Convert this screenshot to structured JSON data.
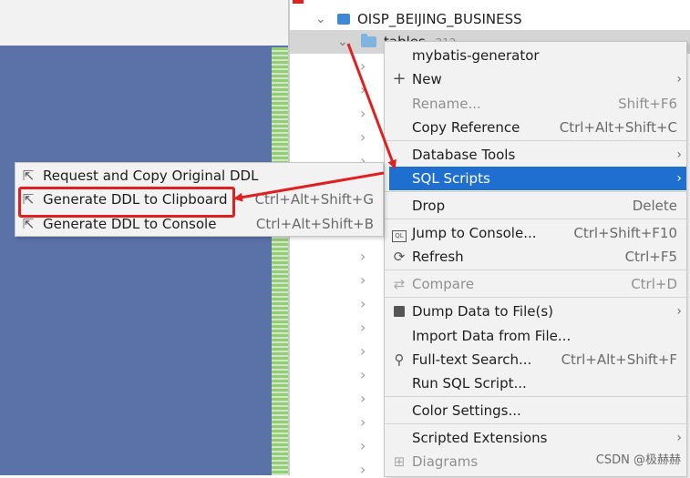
{
  "tree": {
    "rows": [
      {
        "label": "OISP_BEIJING_BUSINESS",
        "icon": "schema-icon"
      },
      {
        "label": "tables",
        "count": "212",
        "icon": "folder-icon"
      }
    ]
  },
  "context_menu": {
    "items": [
      {
        "label": "mybatis-generator",
        "shortcut": "",
        "icon": "",
        "has_submenu": false
      },
      {
        "label": "New",
        "shortcut": "",
        "icon": "plus-icon",
        "has_submenu": true
      },
      {
        "label": "Rename...",
        "shortcut": "Shift+F6",
        "icon": "",
        "has_submenu": false,
        "disabled": true
      },
      {
        "label": "Copy Reference",
        "shortcut": "Ctrl+Alt+Shift+C",
        "icon": "",
        "has_submenu": false
      },
      {
        "label": "Database Tools",
        "shortcut": "",
        "icon": "",
        "has_submenu": true
      },
      {
        "label": "SQL Scripts",
        "shortcut": "",
        "icon": "",
        "has_submenu": true,
        "highlighted": true
      },
      {
        "label": "Drop",
        "shortcut": "Delete",
        "icon": "",
        "has_submenu": false
      },
      {
        "label": "Jump to Console...",
        "shortcut": "Ctrl+Shift+F10",
        "icon": "console-icon",
        "has_submenu": false
      },
      {
        "label": "Refresh",
        "shortcut": "Ctrl+F5",
        "icon": "refresh-icon",
        "has_submenu": false
      },
      {
        "label": "Compare",
        "shortcut": "Ctrl+D",
        "icon": "compare-icon",
        "has_submenu": false,
        "disabled": true
      },
      {
        "label": "Dump Data to File(s)",
        "shortcut": "",
        "icon": "save-icon",
        "has_submenu": true
      },
      {
        "label": "Import Data from File...",
        "shortcut": "",
        "icon": "",
        "has_submenu": false
      },
      {
        "label": "Full-text Search...",
        "shortcut": "Ctrl+Alt+Shift+F",
        "icon": "search-icon",
        "has_submenu": false
      },
      {
        "label": "Run SQL Script...",
        "shortcut": "",
        "icon": "",
        "has_submenu": false
      },
      {
        "label": "Color Settings...",
        "shortcut": "",
        "icon": "",
        "has_submenu": false
      },
      {
        "label": "Scripted Extensions",
        "shortcut": "",
        "icon": "",
        "has_submenu": true
      },
      {
        "label": "Diagrams",
        "shortcut": "",
        "icon": "diagram-icon",
        "has_submenu": false,
        "disabled": true
      }
    ]
  },
  "submenu": {
    "items": [
      {
        "label": "Request and Copy Original DDL",
        "shortcut": "",
        "icon": "export-icon"
      },
      {
        "label": "Generate DDL to Clipboard",
        "shortcut": "Ctrl+Alt+Shift+G",
        "icon": "export-icon",
        "annotated": true
      },
      {
        "label": "Generate DDL to Console",
        "shortcut": "Ctrl+Alt+Shift+B",
        "icon": "export-icon"
      }
    ]
  },
  "watermark": "CSDN @极赫赫",
  "colors": {
    "highlight": "#1f6fd0",
    "annotation": "#e02020",
    "menu_bg": "#f2f2f2",
    "editor_bg": "#5a72a8"
  }
}
